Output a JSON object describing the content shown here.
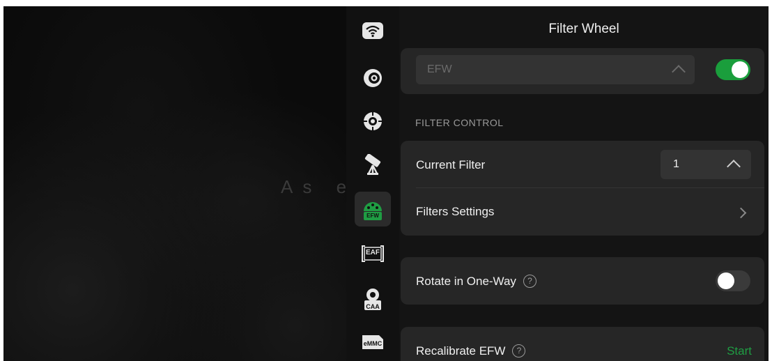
{
  "preview": {
    "overlay_text": "As e"
  },
  "rail": {
    "items": [
      {
        "icon": "wifi-icon"
      },
      {
        "icon": "camera-lens-icon"
      },
      {
        "icon": "guide-crosshair-icon"
      },
      {
        "icon": "telescope-mount-icon"
      },
      {
        "icon": "filter-wheel-icon",
        "badge": "EFW",
        "active": true
      },
      {
        "icon": "focuser-icon",
        "badge": "EAF"
      },
      {
        "icon": "rotator-icon",
        "badge": "CAA"
      },
      {
        "icon": "storage-icon",
        "badge": "eMMC"
      }
    ]
  },
  "panel": {
    "title": "Filter Wheel",
    "device_select": {
      "value": "EFW"
    },
    "device_enabled": true,
    "section_label": "FILTER CONTROL",
    "current_filter": {
      "label": "Current Filter",
      "value": "1"
    },
    "filters_settings": {
      "label": "Filters Settings"
    },
    "rotate_one_way": {
      "label": "Rotate in One-Way",
      "help": "?",
      "enabled": false
    },
    "recalibrate": {
      "label": "Recalibrate EFW",
      "help": "?",
      "action": "Start"
    }
  },
  "colors": {
    "accent_green": "#1a9e3c",
    "panel_bg": "#141414",
    "card_bg": "#262626"
  }
}
